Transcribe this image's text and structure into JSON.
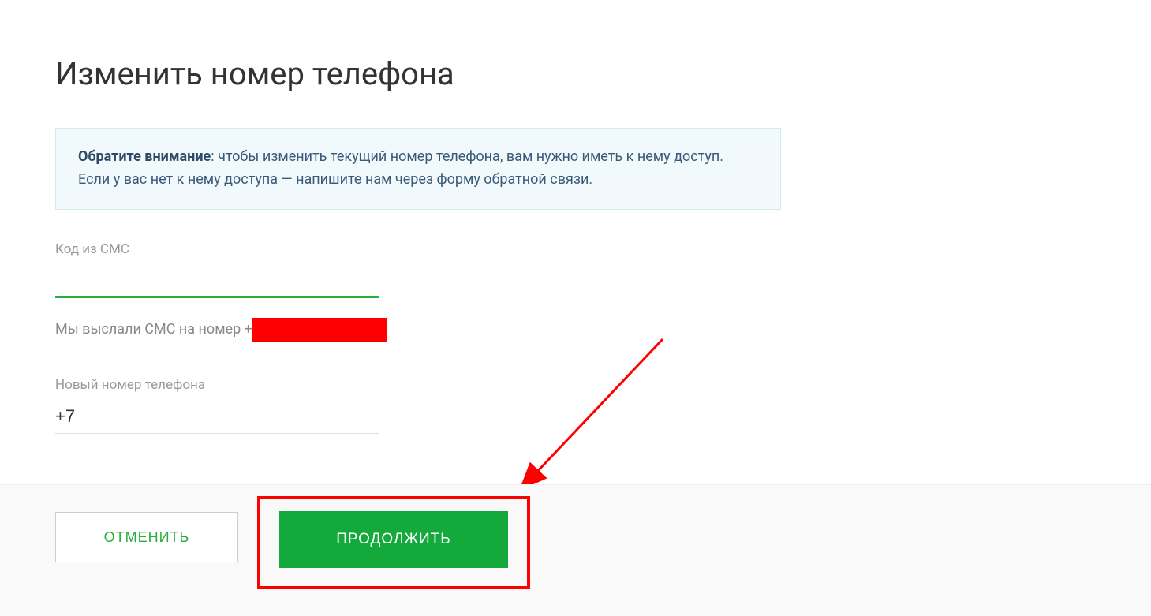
{
  "title": "Изменить номер телефона",
  "notice": {
    "bold_prefix": "Обратите внимание",
    "text_part1": ": чтобы изменить текущий номер телефона, вам нужно иметь к нему доступ. Если у вас нет к нему доступа — напишите нам через ",
    "link_text": "форму обратной связи",
    "text_part2": "."
  },
  "sms_code": {
    "label": "Код из СМС",
    "value": ""
  },
  "sms_sent": {
    "text": "Мы выслали СМС на номер +"
  },
  "new_phone": {
    "label": "Новый номер телефона",
    "value": "+7"
  },
  "buttons": {
    "cancel": "ОТМЕНИТЬ",
    "continue": "ПРОДОЛЖИТЬ"
  }
}
